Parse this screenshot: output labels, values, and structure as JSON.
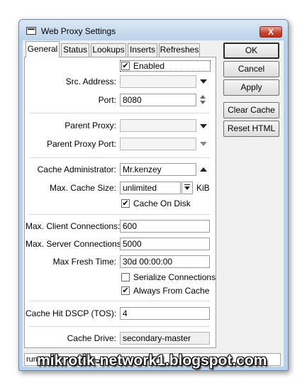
{
  "window": {
    "title": "Web Proxy Settings",
    "close_glyph": "X"
  },
  "tabs": [
    {
      "label": "General",
      "active": true
    },
    {
      "label": "Status"
    },
    {
      "label": "Lookups"
    },
    {
      "label": "Inserts"
    },
    {
      "label": "Refreshes"
    }
  ],
  "general": {
    "enabled": {
      "label": "Enabled",
      "checked": true
    },
    "src_address": {
      "label": "Src. Address:",
      "value": ""
    },
    "port": {
      "label": "Port:",
      "value": "8080"
    },
    "parent_proxy": {
      "label": "Parent Proxy:",
      "value": ""
    },
    "parent_proxy_port": {
      "label": "Parent Proxy Port:",
      "value": ""
    },
    "cache_administrator": {
      "label": "Cache Administrator:",
      "value": "Mr.kenzey"
    },
    "max_cache_size": {
      "label": "Max. Cache Size:",
      "value": "unlimited",
      "unit": "KiB"
    },
    "cache_on_disk": {
      "label": "Cache On Disk",
      "checked": true
    },
    "max_client_connections": {
      "label": "Max. Client Connections:",
      "value": "600"
    },
    "max_server_connections": {
      "label": "Max. Server Connections:",
      "value": "5000"
    },
    "max_fresh_time": {
      "label": "Max Fresh Time:",
      "value": "30d 00:00:00"
    },
    "serialize_connections": {
      "label": "Serialize Connections",
      "checked": false
    },
    "always_from_cache": {
      "label": "Always From Cache",
      "checked": true
    },
    "cache_hit_dscp": {
      "label": "Cache Hit DSCP (TOS):",
      "value": "4"
    },
    "cache_drive": {
      "label": "Cache Drive:",
      "value": "secondary-master"
    }
  },
  "buttons": {
    "ok": "OK",
    "cancel": "Cancel",
    "apply": "Apply",
    "clear_cache": "Clear Cache",
    "reset_html": "Reset HTML"
  },
  "status": {
    "text": "running"
  },
  "watermark": "mikrotik-network1.blogspot.com",
  "icons": {
    "check": "✔",
    "dropdown": "dropdown-arrow-icon",
    "spinner": "spinner-icon",
    "collapse": "collapse-up-icon"
  },
  "colors": {
    "titlebar": "#bcd3ea",
    "close_button": "#c6422c",
    "panel": "#ffffff",
    "dialog": "#f0f0f0"
  }
}
